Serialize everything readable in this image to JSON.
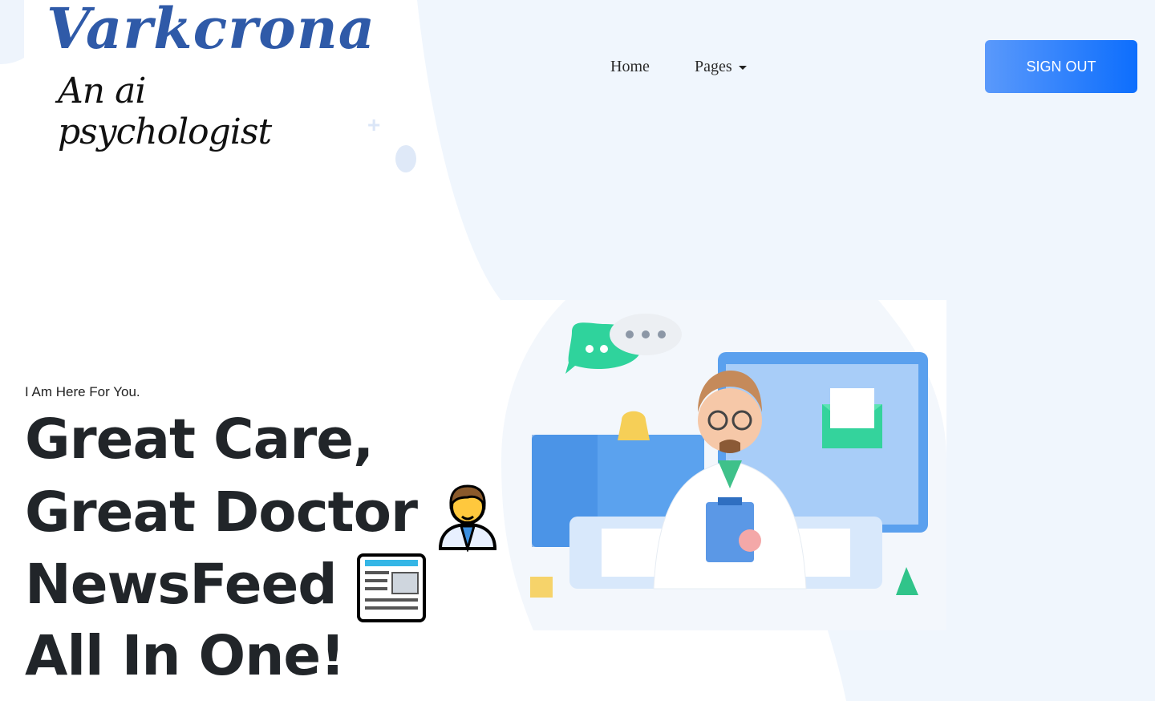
{
  "brand": {
    "name": "Varkcrona",
    "tagline": "An ai psychologist"
  },
  "nav": {
    "home_label": "Home",
    "pages_label": "Pages"
  },
  "auth": {
    "signout_label": "SIGN OUT"
  },
  "hero": {
    "eyebrow": "I Am Here For You.",
    "line1": "Great Care,",
    "line2": "Great Doctor",
    "line3": "NewsFeed",
    "line4": "All In One!"
  },
  "icons": {
    "doctor": "doctor-emoji-icon",
    "newspaper": "newspaper-emoji-icon",
    "nav_caret": "chevron-down-icon"
  },
  "colors": {
    "accent": "#0d6efd",
    "brand_blue": "#2f5aa8",
    "background_blob": "#f0f6fd",
    "heading": "#212529"
  }
}
